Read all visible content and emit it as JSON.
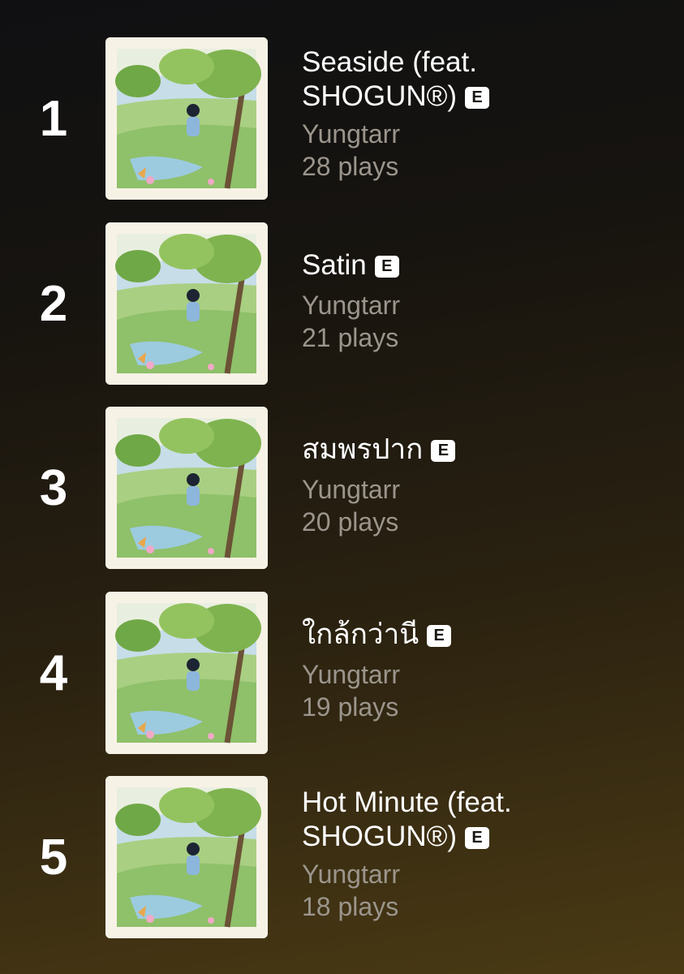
{
  "tracks": [
    {
      "rank": "1",
      "title_line1": "Seaside (feat.",
      "title_line2": "SHOGUN®)",
      "explicit_label": "E",
      "artist": "Yungtarr",
      "plays": "28 plays",
      "artwork_icon": "album-art-icon"
    },
    {
      "rank": "2",
      "title_line1": "Satin",
      "title_line2": "",
      "explicit_label": "E",
      "artist": "Yungtarr",
      "plays": "21 plays",
      "artwork_icon": "album-art-icon"
    },
    {
      "rank": "3",
      "title_line1": "สมพรปาก",
      "title_line2": "",
      "explicit_label": "E",
      "artist": "Yungtarr",
      "plays": "20 plays",
      "artwork_icon": "album-art-icon"
    },
    {
      "rank": "4",
      "title_line1": "ใกล้กว่านี",
      "title_line2": "",
      "explicit_label": "E",
      "artist": "Yungtarr",
      "plays": "19 plays",
      "artwork_icon": "album-art-icon"
    },
    {
      "rank": "5",
      "title_line1": "Hot Minute (feat.",
      "title_line2": "SHOGUN®)",
      "explicit_label": "E",
      "artist": "Yungtarr",
      "plays": "18 plays",
      "artwork_icon": "album-art-icon"
    }
  ],
  "colors": {
    "background_top": "#101012",
    "background_bottom": "#4a3a14",
    "secondary_text": "#9b958c",
    "badge_bg": "#ffffff"
  }
}
